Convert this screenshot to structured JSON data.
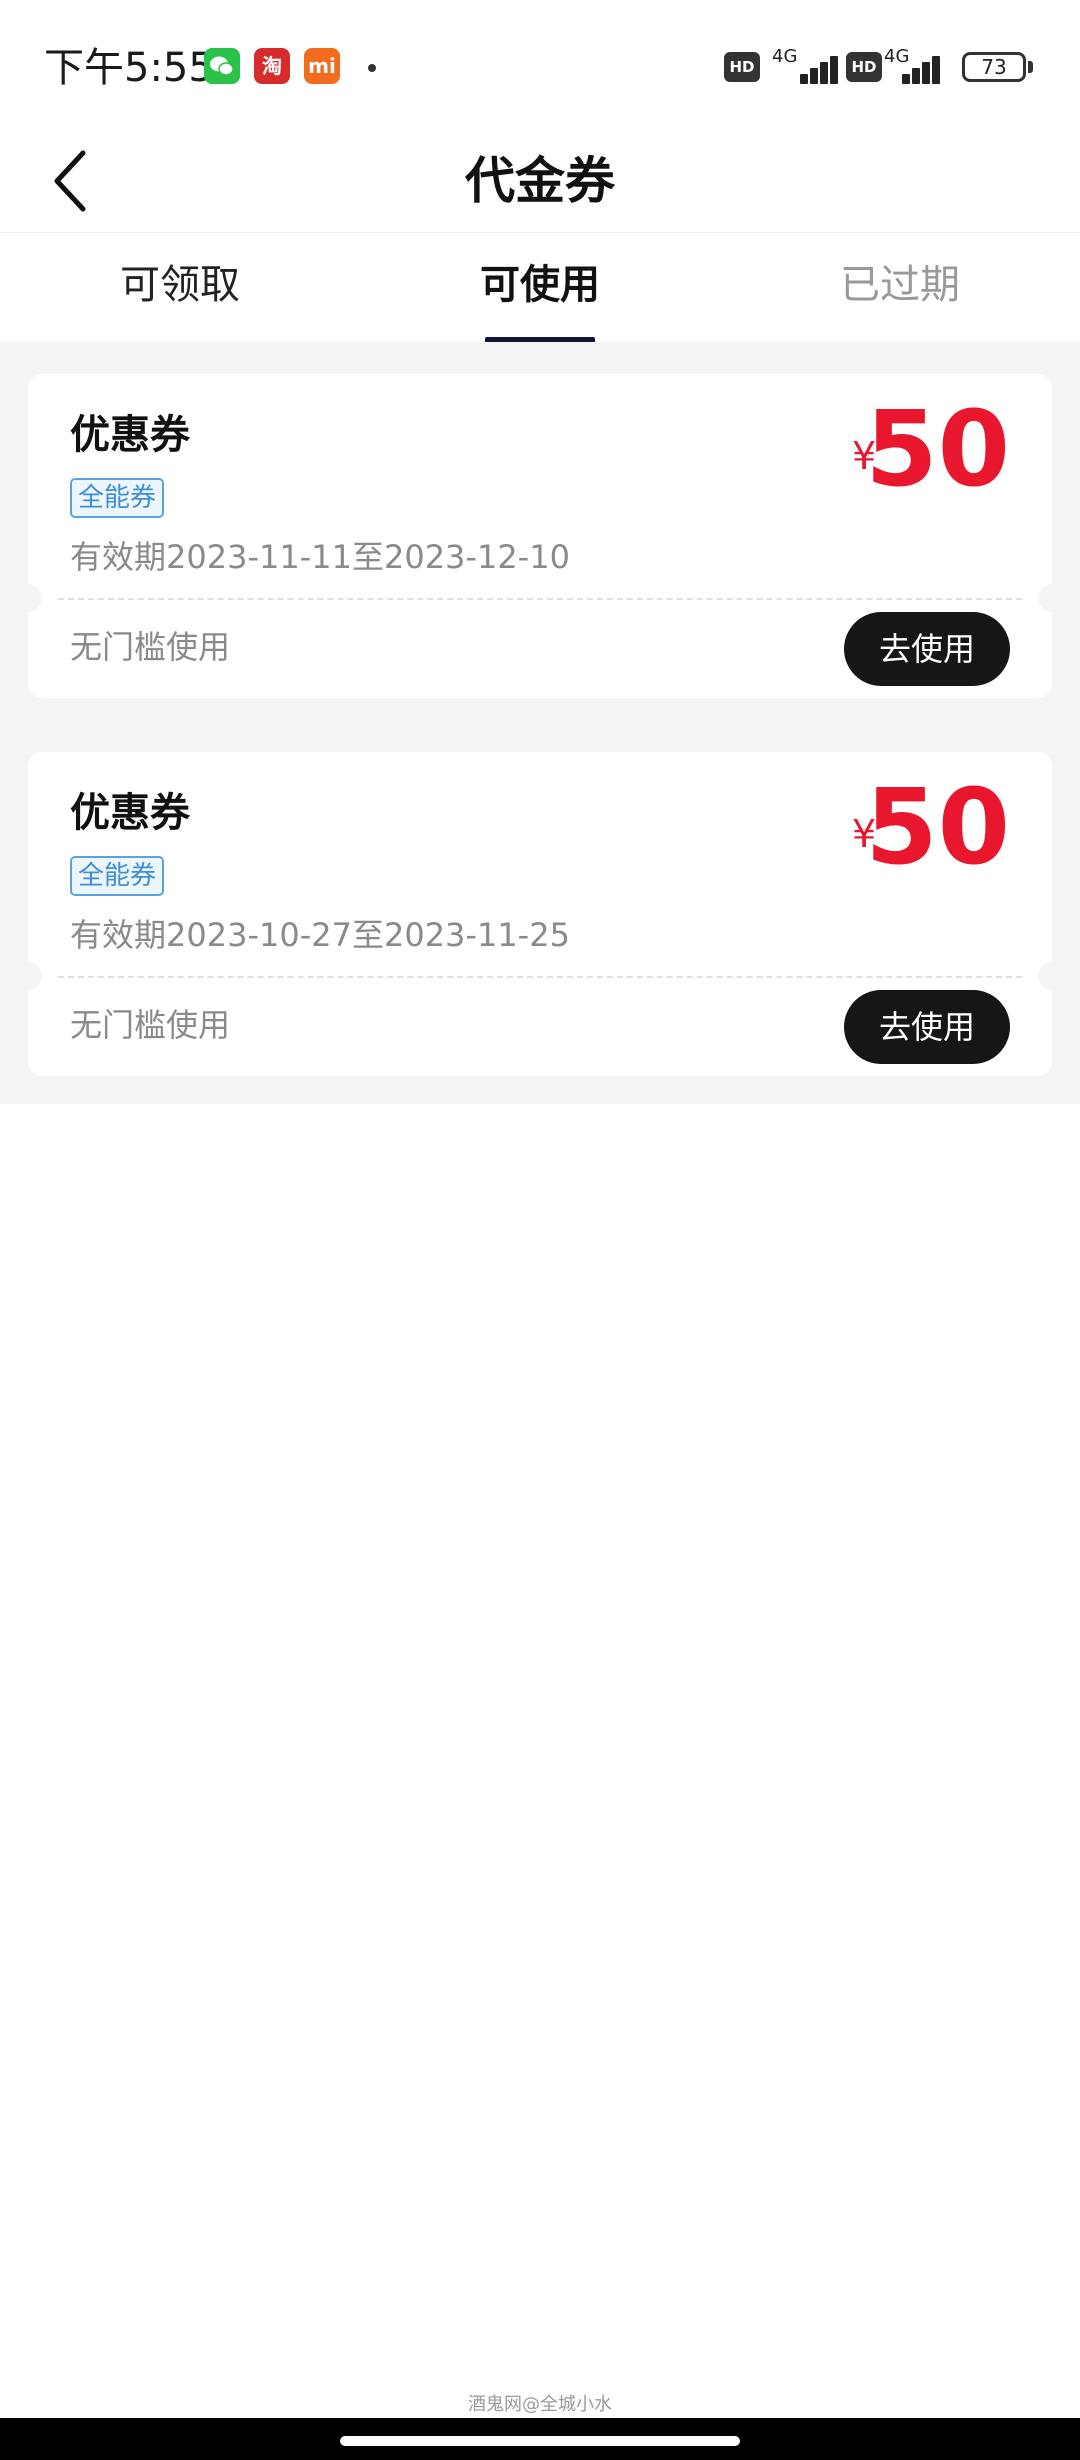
{
  "status_bar": {
    "time": "下午5:55",
    "apps": {
      "wechat_icon": "wechat-icon",
      "taobao_label": "淘",
      "mi_label": "mi"
    },
    "hd_label": "HD",
    "network_label": "4G",
    "battery_level": "73"
  },
  "nav": {
    "title": "代金券"
  },
  "tabs": [
    {
      "label": "可领取"
    },
    {
      "label": "可使用"
    },
    {
      "label": "已过期"
    }
  ],
  "active_tab": 1,
  "coupons": [
    {
      "name": "优惠券",
      "tag": "全能券",
      "validity": "有效期2023-11-11至2023-12-10",
      "currency": "¥",
      "amount": "50",
      "condition": "无门槛使用",
      "button_label": "去使用"
    },
    {
      "name": "优惠券",
      "tag": "全能券",
      "validity": "有效期2023-10-27至2023-11-25",
      "currency": "¥",
      "amount": "50",
      "condition": "无门槛使用",
      "button_label": "去使用"
    }
  ],
  "watermark": "酒鬼网@全城小水",
  "colors": {
    "accent_red": "#e8172d",
    "tab_indicator": "#0f1433",
    "tag_blue": "#3a8fd8",
    "button_dark": "#161616"
  }
}
